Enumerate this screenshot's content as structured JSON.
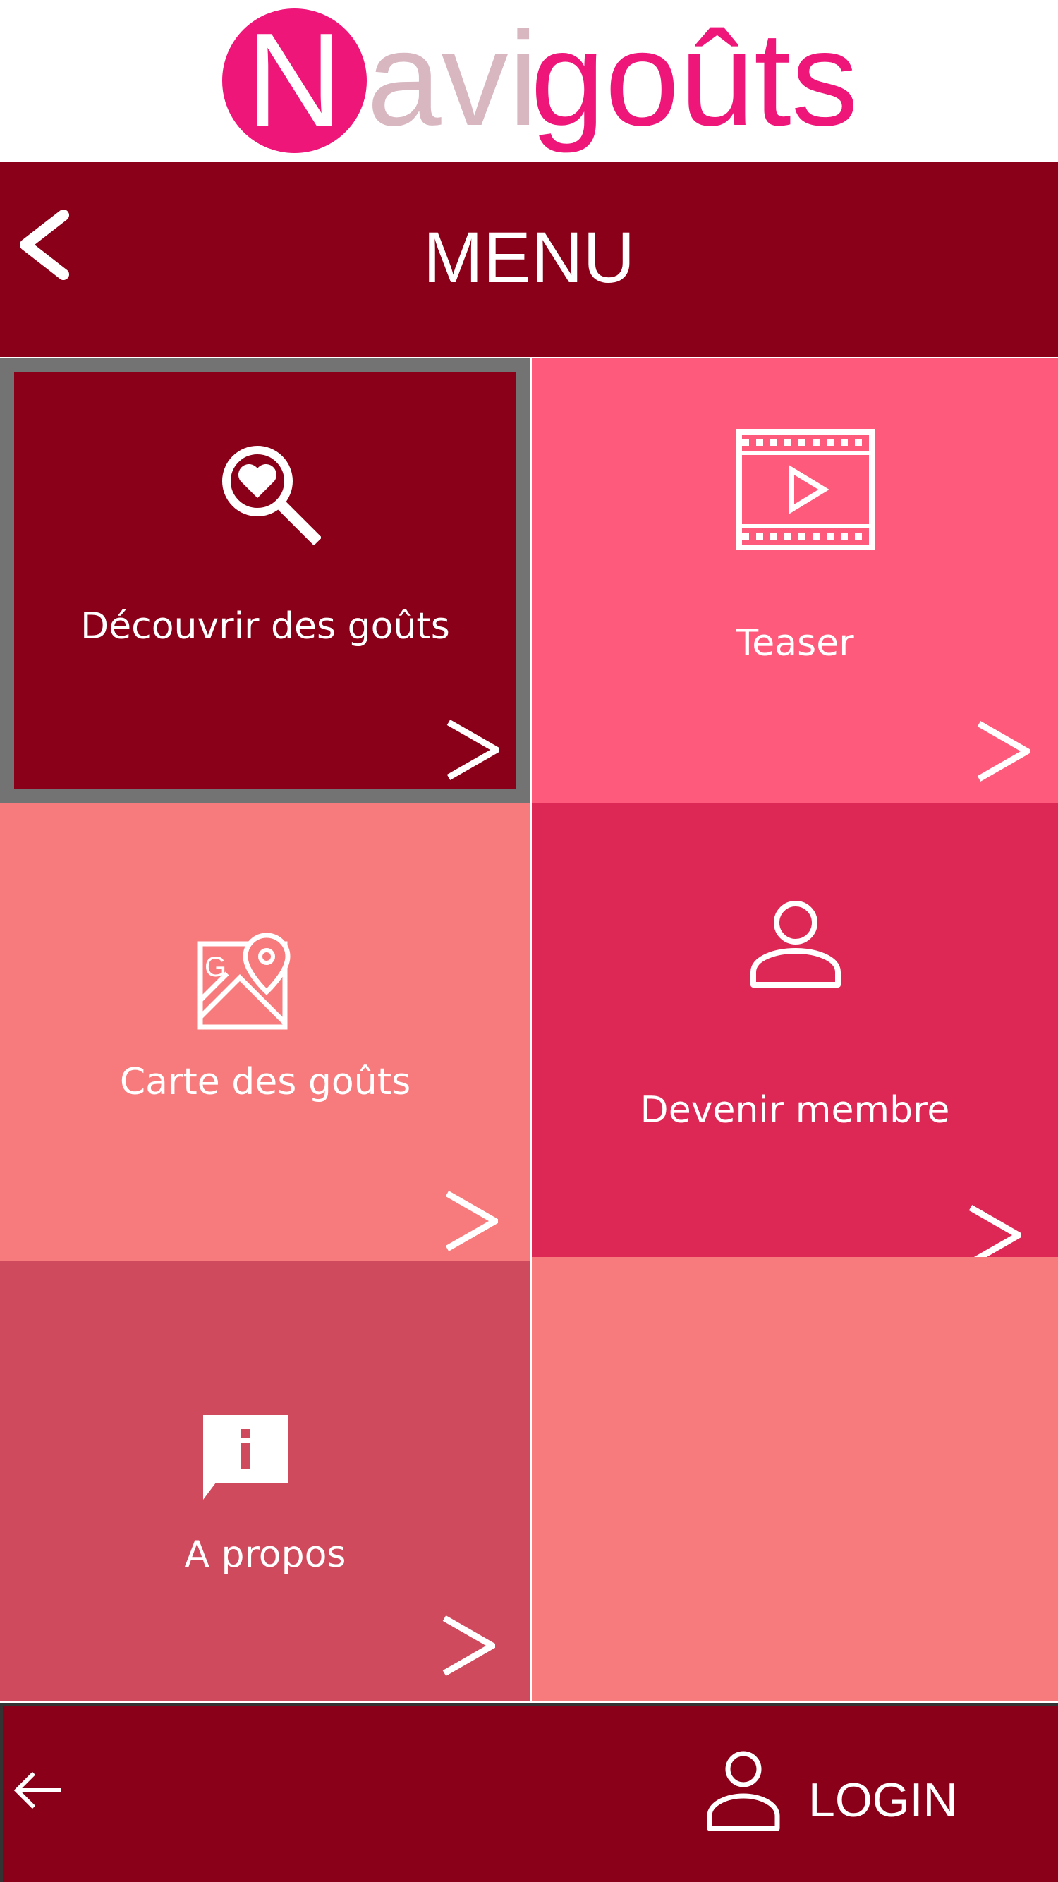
{
  "app": {
    "logo": {
      "initial": "N",
      "part2": "avi",
      "part3": "goûts"
    }
  },
  "header": {
    "title": "MENU",
    "back_icon": "chevron-left-icon"
  },
  "menu": {
    "tiles": [
      {
        "label": "Découvrir des goûts",
        "icon": "heart-search-icon",
        "selected": true
      },
      {
        "label": "Teaser",
        "icon": "film-play-icon"
      },
      {
        "label": "Carte des goûts",
        "icon": "map-pin-icon"
      },
      {
        "label": "Devenir membre",
        "icon": "user-icon"
      },
      {
        "label": "A propos",
        "icon": "info-chat-icon"
      }
    ]
  },
  "footer": {
    "back_icon": "arrow-left-icon",
    "login_label": "LOGIN",
    "login_icon": "user-icon"
  },
  "colors": {
    "brand_pink": "#ee1679",
    "logo_secondary": "#d8b7c1",
    "header_bg": "#8b0019",
    "tile_discover": "#8b0019",
    "tile_teaser": "#fe5b7c",
    "tile_map": "#f77b7c",
    "tile_member": "#dd2855",
    "tile_about": "#d04a5d",
    "selection_border": "#737373"
  }
}
